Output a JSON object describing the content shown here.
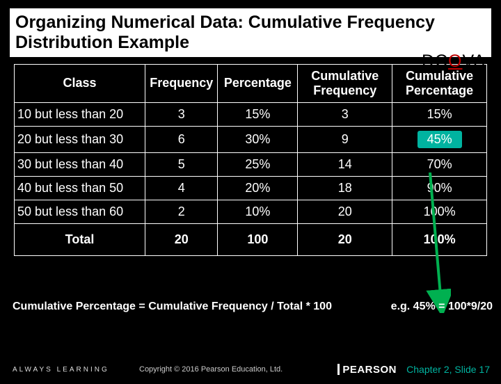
{
  "title": "Organizing Numerical Data: Cumulative Frequency Distribution Example",
  "dcova": {
    "pre": "DC",
    "hot": "O",
    "post": "VA"
  },
  "table": {
    "headers": [
      "Class",
      "Frequency",
      "Percentage",
      "Cumulative Frequency",
      "Cumulative Percentage"
    ],
    "rows": [
      {
        "class": "10 but less than 20",
        "freq": "3",
        "pct": "15%",
        "cfreq": "3",
        "cpct": "15%"
      },
      {
        "class": "20 but less than 30",
        "freq": "6",
        "pct": "30%",
        "cfreq": "9",
        "cpct": "45%",
        "hl": true
      },
      {
        "class": "30 but less than 40",
        "freq": "5",
        "pct": "25%",
        "cfreq": "14",
        "cpct": "70%"
      },
      {
        "class": "40 but less than 50",
        "freq": "4",
        "pct": "20%",
        "cfreq": "18",
        "cpct": "90%"
      },
      {
        "class": "50 but less than 60",
        "freq": "2",
        "pct": "10%",
        "cfreq": "20",
        "cpct": "100%"
      }
    ],
    "total": {
      "label": "Total",
      "freq": "20",
      "pct": "100",
      "cfreq": "20",
      "cpct": "100%"
    }
  },
  "formula": "Cumulative Percentage = Cumulative Frequency / Total * 100",
  "example": "e.g. 45% = 100*9/20",
  "footer": {
    "always": "ALWAYS LEARNING",
    "copyright": "Copyright © 2016 Pearson Education, Ltd.",
    "brand": "PEARSON",
    "chapter": "Chapter 2, Slide 17"
  },
  "chart_data": {
    "type": "table",
    "title": "Cumulative Frequency Distribution",
    "columns": [
      "Class",
      "Frequency",
      "Percentage",
      "Cumulative Frequency",
      "Cumulative Percentage"
    ],
    "rows": [
      [
        "10 but less than 20",
        3,
        15,
        3,
        15
      ],
      [
        "20 but less than 30",
        6,
        30,
        9,
        45
      ],
      [
        "30 but less than 40",
        5,
        25,
        14,
        70
      ],
      [
        "40 but less than 50",
        4,
        20,
        18,
        90
      ],
      [
        "50 but less than 60",
        2,
        10,
        20,
        100
      ]
    ],
    "total": [
      "Total",
      20,
      100,
      20,
      100
    ]
  }
}
